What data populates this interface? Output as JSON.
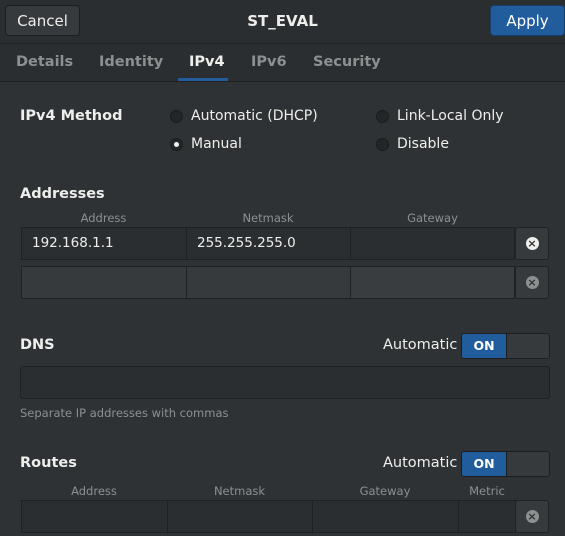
{
  "header": {
    "cancel_label": "Cancel",
    "title": "ST_EVAL",
    "apply_label": "Apply"
  },
  "tabs": [
    {
      "label": "Details"
    },
    {
      "label": "Identity"
    },
    {
      "label": "IPv4",
      "active": true
    },
    {
      "label": "IPv6"
    },
    {
      "label": "Security"
    }
  ],
  "ipv4_method": {
    "label": "IPv4 Method",
    "options": [
      {
        "label": "Automatic (DHCP)",
        "checked": false
      },
      {
        "label": "Link-Local Only",
        "checked": false
      },
      {
        "label": "Manual",
        "checked": true
      },
      {
        "label": "Disable",
        "checked": false
      }
    ]
  },
  "addresses": {
    "label": "Addresses",
    "columns": [
      "Address",
      "Netmask",
      "Gateway"
    ],
    "rows": [
      {
        "address": "192.168.1.1",
        "netmask": "255.255.255.0",
        "gateway": ""
      },
      {
        "address": "",
        "netmask": "",
        "gateway": ""
      }
    ]
  },
  "dns": {
    "label": "DNS",
    "automatic_label": "Automatic",
    "toggle_label": "ON",
    "value": "",
    "hint": "Separate IP addresses with commas"
  },
  "routes": {
    "label": "Routes",
    "automatic_label": "Automatic",
    "toggle_label": "ON",
    "columns": [
      "Address",
      "Netmask",
      "Gateway",
      "Metric"
    ]
  },
  "colors": {
    "accent": "#215d9c",
    "background": "#2f3234",
    "text": "#eeeeec",
    "muted": "#8d9091"
  }
}
